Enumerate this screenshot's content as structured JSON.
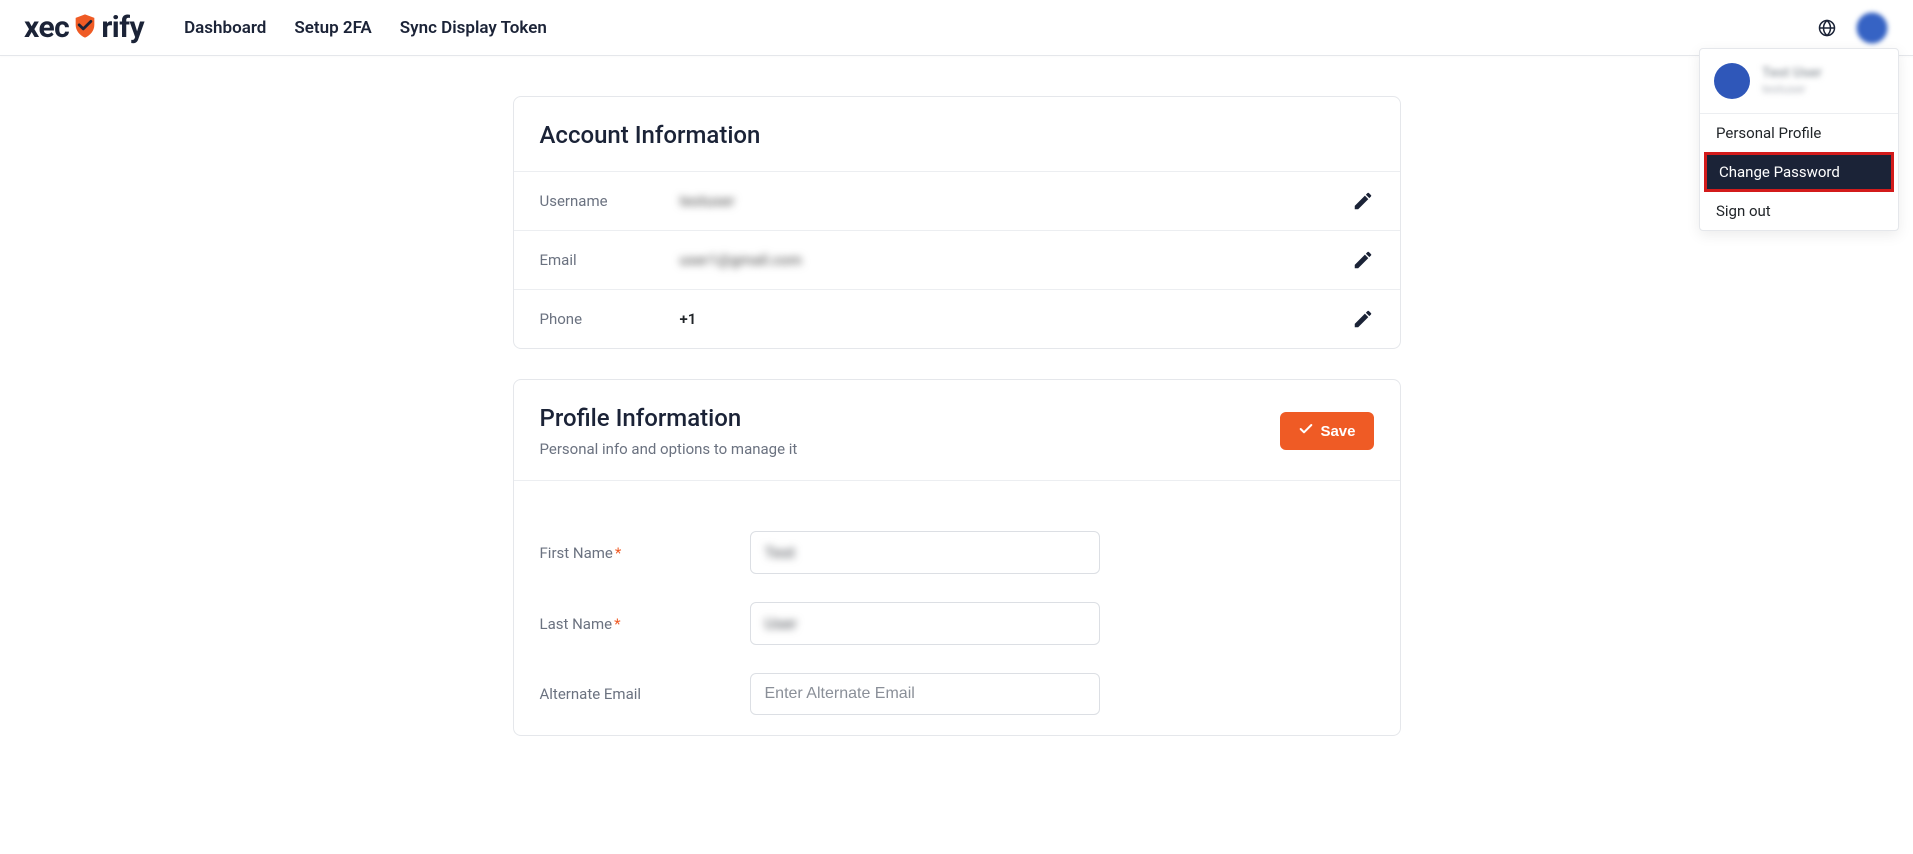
{
  "brand": {
    "name_part1": "xec",
    "name_part2": "rify"
  },
  "nav": {
    "dashboard": "Dashboard",
    "setup2fa": "Setup 2FA",
    "sync": "Sync Display Token"
  },
  "dropdown": {
    "user_name": "Test User",
    "user_sub": "testuser",
    "personal_profile": "Personal Profile",
    "change_password": "Change Password",
    "sign_out": "Sign out"
  },
  "account": {
    "title": "Account Information",
    "username_label": "Username",
    "username_value": "testuser",
    "email_label": "Email",
    "email_value": "user1@gmail.com",
    "phone_label": "Phone",
    "phone_value": "+1"
  },
  "profile": {
    "title": "Profile Information",
    "subtitle": "Personal info and options to manage it",
    "save": "Save",
    "first_name_label": "First Name",
    "first_name_value": "Test",
    "last_name_label": "Last Name",
    "last_name_value": "User",
    "alt_email_label": "Alternate Email",
    "alt_email_placeholder": "Enter Alternate Email"
  }
}
